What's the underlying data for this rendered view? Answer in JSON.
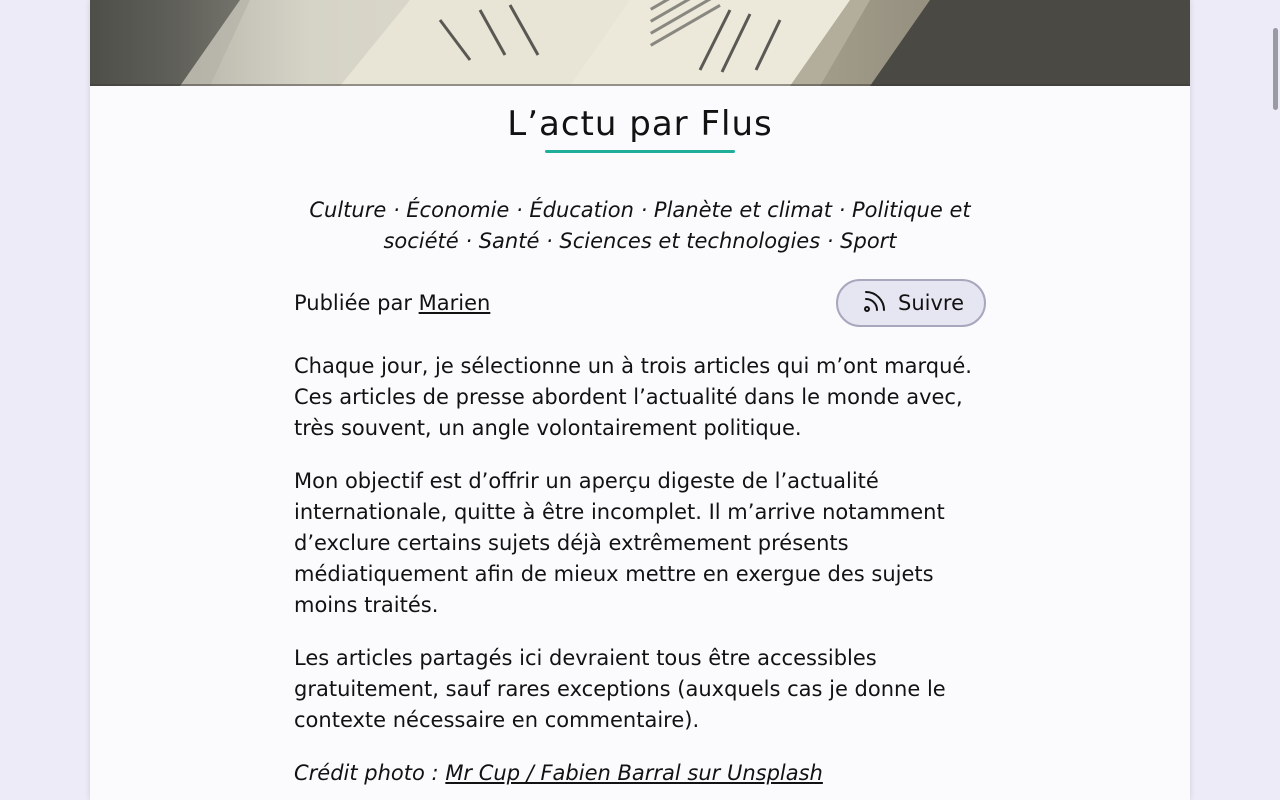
{
  "collection": {
    "title": "L’actu par Flus",
    "topics": "Culture · Économie · Éducation · Planète et climat · Politique et société · Santé · Sciences et technologies · Sport",
    "published_by_label": "Publiée par",
    "author": "Marien",
    "follow_label": "Suivre",
    "description": [
      "Chaque jour, je sélectionne un à trois articles qui m’ont marqué. Ces articles de presse abordent l’actualité dans le monde avec, très souvent, un angle volontairement politique.",
      "Mon objectif est d’offrir un aperçu digeste de l’actualité internationale, quitte à être incomplet. Il m’arrive notamment d’exclure certains sujets déjà extrêmement présents médiatiquement afin de mieux mettre en exergue des sujets moins traités.",
      "Les articles partagés ici devraient tous être accessibles gratuitement, sauf rares exceptions (auxquels cas je donne le contexte nécessaire en commentaire)."
    ],
    "credit_label": "Crédit photo :",
    "credit_link": "Mr Cup / Fabien Barral sur Unsplash"
  },
  "icons": {
    "follow": "rss-feed-icon"
  },
  "colors": {
    "accent": "#1fae9a",
    "button_bg": "#e6e6f2",
    "page_bg": "#ecebf7"
  }
}
